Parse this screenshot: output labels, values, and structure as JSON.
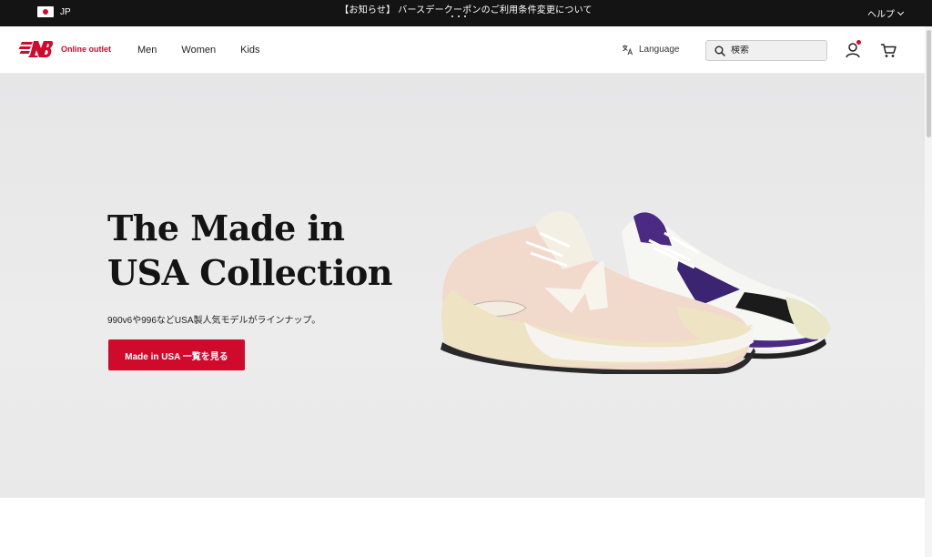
{
  "topbar": {
    "region": "JP",
    "notice": "【お知らせ】 バースデークーポンのご利用条件変更について",
    "help": "ヘルプ"
  },
  "header": {
    "brand": "Online outlet",
    "nav": [
      "Men",
      "Women",
      "Kids"
    ],
    "language": "Language",
    "search_placeholder": "検索"
  },
  "hero": {
    "title": "The Made in USA Collection",
    "subtitle": "990v6や996などUSA製人気モデルがラインナップ。",
    "button": "Made in USA 一覧を見る"
  },
  "colors": {
    "brand_red": "#cf0a2c",
    "topbar_bg": "#151415",
    "hero_bg": "#e9e9ea"
  },
  "icons": [
    "flag-icon",
    "chevron-down-icon",
    "nb-logo-icon",
    "translate-icon",
    "search-icon",
    "user-icon",
    "cart-icon"
  ]
}
